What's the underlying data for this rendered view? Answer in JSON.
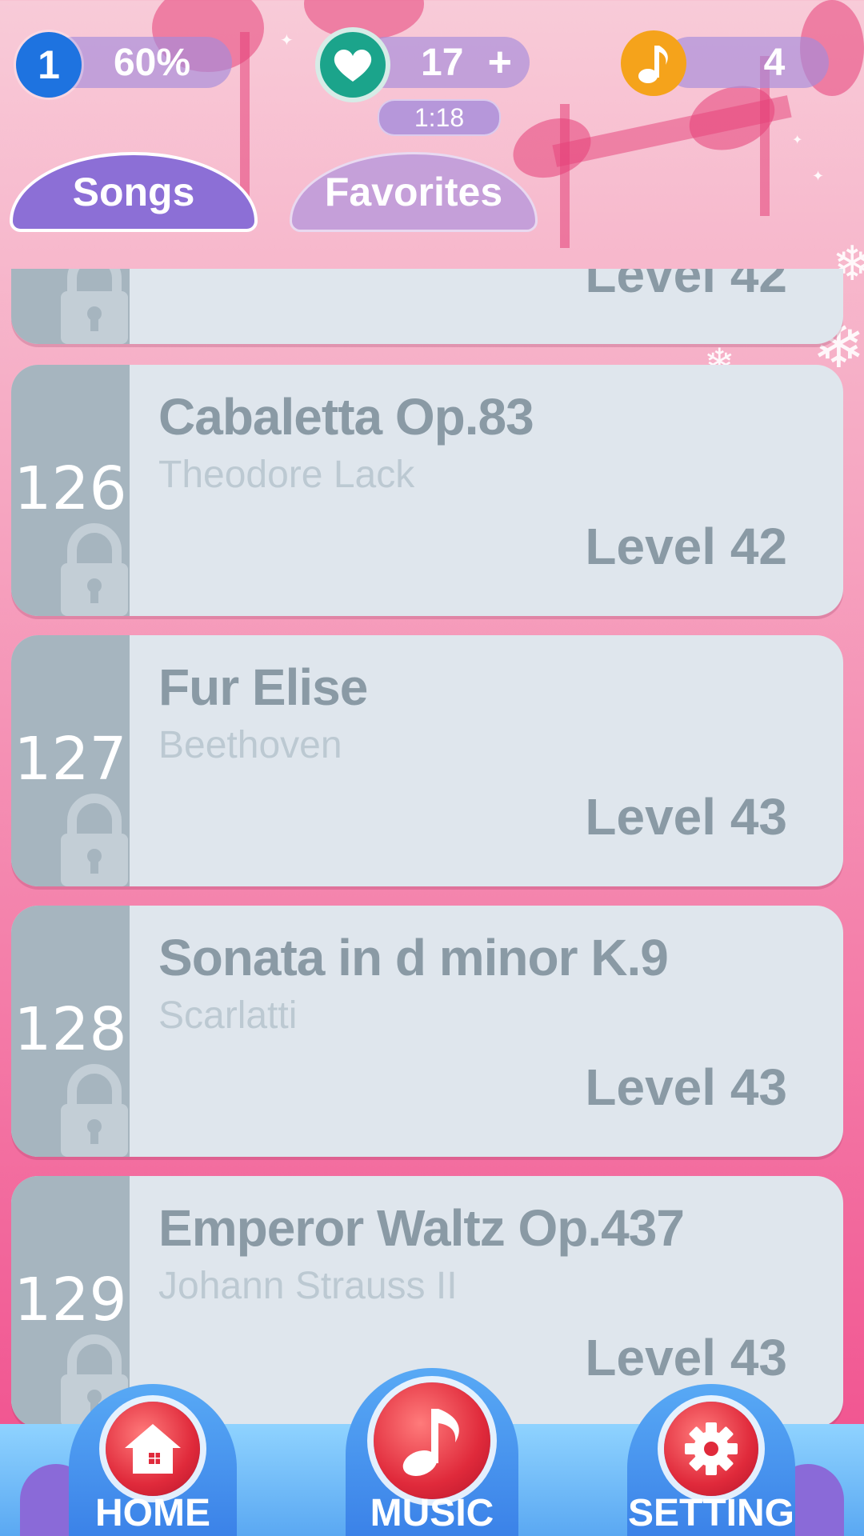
{
  "status": {
    "player_level": "1",
    "progress_text": "60%",
    "lives_count": "17",
    "add_label": "+",
    "timer": "1:18",
    "notes_count": "4"
  },
  "tabs": [
    {
      "label": "Songs",
      "active": true
    },
    {
      "label": "Favorites",
      "active": false
    }
  ],
  "songs": [
    {
      "number": "",
      "title": "",
      "composer": "",
      "level": "Level 42",
      "locked": true
    },
    {
      "number": "126",
      "title": "Cabaletta Op.83",
      "composer": "Theodore Lack",
      "level": "Level 42",
      "locked": true
    },
    {
      "number": "127",
      "title": "Fur Elise",
      "composer": "Beethoven",
      "level": "Level 43",
      "locked": true
    },
    {
      "number": "128",
      "title": "Sonata in d minor K.9",
      "composer": "Scarlatti",
      "level": "Level 43",
      "locked": true
    },
    {
      "number": "129",
      "title": "Emperor Waltz Op.437",
      "composer": "Johann Strauss II",
      "level": "Level 43",
      "locked": true
    }
  ],
  "nav": {
    "home": "HOME",
    "music": "MUSIC",
    "setting": "SETTING"
  },
  "colors": {
    "accent_purple": "#8c6fd6",
    "card_bg": "#dfe6ed",
    "lock_strip": "#a6b5bf",
    "text_gray": "#8a9aa5",
    "nav_blue": "#5aa8f2",
    "orb_red": "#e02a3b"
  }
}
